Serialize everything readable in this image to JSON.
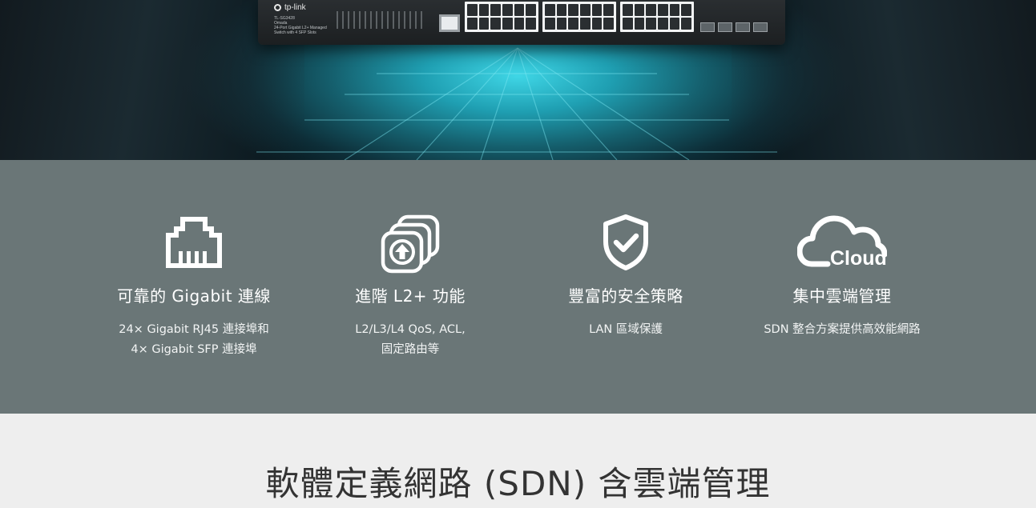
{
  "hero": {
    "product_image": {
      "brand_logo_text": "tp-link",
      "model_label": "TL-SG3428",
      "brand_sub_label": "Omada",
      "description_lines": [
        "24-Port Gigabit L2+ Managed",
        "Switch with 4 SFP Slots"
      ]
    }
  },
  "features": [
    {
      "icon": "ethernet-port-icon",
      "title": "可靠的 Gigabit 連線",
      "desc_lines": [
        "24× Gigabit RJ45 連接埠和",
        "4× Gigabit SFP 連接埠"
      ]
    },
    {
      "icon": "stacked-layers-upload-icon",
      "title": "進階 L2+ 功能",
      "desc_lines": [
        "L2/L3/L4 QoS, ACL,",
        "固定路由等"
      ]
    },
    {
      "icon": "shield-check-icon",
      "title": "豐富的安全策略",
      "desc_lines": [
        "LAN 區域保護"
      ]
    },
    {
      "icon": "cloud-icon",
      "icon_text": "Cloud",
      "title": "集中雲端管理",
      "desc_lines": [
        "SDN 整合方案提供高效能網路"
      ]
    }
  ],
  "section": {
    "heading": "軟體定義網路 (SDN) 含雲端管理"
  },
  "colors": {
    "features_band": "#6a7677",
    "page_background": "#eeeeee",
    "hero_glow": "#3fd6e6",
    "heading_text": "#333333"
  }
}
